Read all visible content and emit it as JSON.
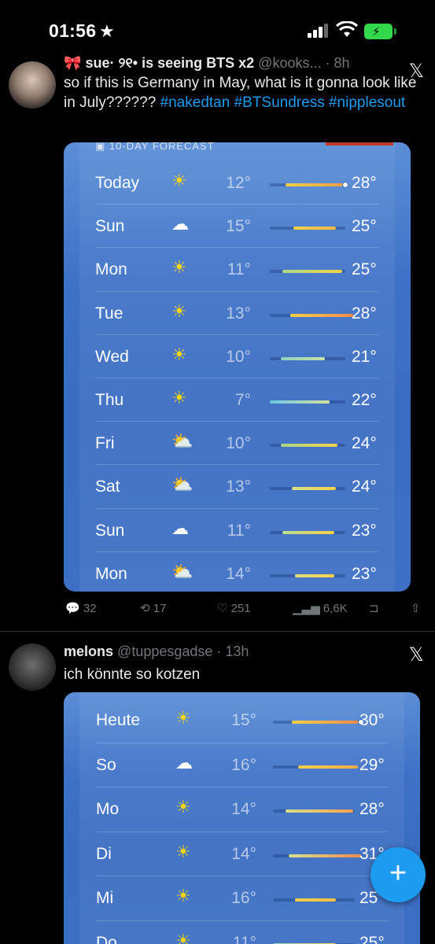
{
  "status_bar": {
    "time": "01:56"
  },
  "tweet1": {
    "header": "sue· ୨୧• is seeing BTS x2",
    "handle": "@kooks... · 8h",
    "text_plain": "so if this is Germany in May, what is it gonna look like in July?????? ",
    "hashtags": [
      "#nakedtan",
      "#BTSundress",
      "#nipplesout"
    ],
    "forecast_header": "10-DAY FORECAST",
    "rows": [
      {
        "day": "Today",
        "icon": "sun-icon",
        "lo": "12°",
        "hi": "28°"
      },
      {
        "day": "Sun",
        "icon": "cloud-icon",
        "lo": "15°",
        "hi": "25°"
      },
      {
        "day": "Mon",
        "icon": "sun-icon",
        "lo": "11°",
        "hi": "25°"
      },
      {
        "day": "Tue",
        "icon": "sun-icon",
        "lo": "13°",
        "hi": "28°"
      },
      {
        "day": "Wed",
        "icon": "sun-icon",
        "lo": "10°",
        "hi": "21°"
      },
      {
        "day": "Thu",
        "icon": "sun-icon",
        "lo": "7°",
        "hi": "22°"
      },
      {
        "day": "Fri",
        "icon": "partly-cloudy-icon",
        "lo": "10°",
        "hi": "24°"
      },
      {
        "day": "Sat",
        "icon": "partly-cloudy-icon",
        "lo": "13°",
        "hi": "24°"
      },
      {
        "day": "Sun",
        "icon": "cloud-icon",
        "lo": "11°",
        "hi": "23°"
      },
      {
        "day": "Mon",
        "icon": "partly-cloudy-icon",
        "lo": "14°",
        "hi": "23°"
      }
    ],
    "actions": {
      "replies": "32",
      "reposts": "17",
      "likes": "251",
      "views": "6,6K"
    }
  },
  "tweet2": {
    "name": "melons",
    "handle": "@tuppesgadse · 13h",
    "text": "ich könnte so kotzen",
    "rows": [
      {
        "day": "Heute",
        "icon": "sun-icon",
        "lo": "15°",
        "hi": "30°"
      },
      {
        "day": "So",
        "icon": "cloud-icon",
        "lo": "16°",
        "hi": "29°"
      },
      {
        "day": "Mo",
        "icon": "sun-icon",
        "lo": "14°",
        "hi": "28°"
      },
      {
        "day": "Di",
        "icon": "sun-icon",
        "lo": "14°",
        "hi": "31°"
      },
      {
        "day": "Mi",
        "icon": "sun-icon",
        "lo": "16°",
        "hi": "25°"
      },
      {
        "day": "Do",
        "icon": "sun-icon",
        "lo": "11°",
        "hi": "25°"
      }
    ]
  },
  "fab": {
    "label": "+"
  },
  "colors": {
    "accent": "#1d9bf0",
    "weather_bg": "#3f72c6",
    "sun": "#ffd60a"
  }
}
